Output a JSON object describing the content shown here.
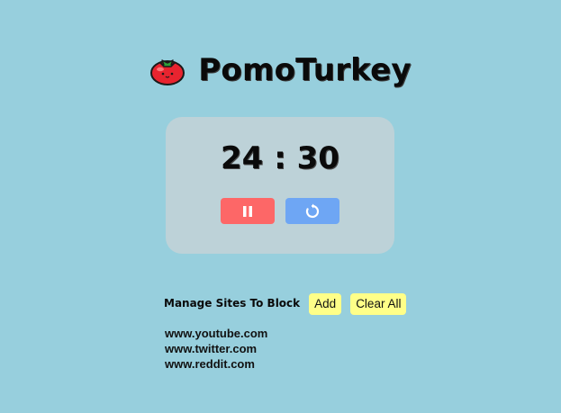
{
  "app": {
    "title": "PomoTurkey"
  },
  "timer": {
    "minutes": "24",
    "separator": ":",
    "seconds": "30"
  },
  "controls": {
    "pause_icon": "pause-icon",
    "reset_icon": "reset-icon"
  },
  "block_manager": {
    "label": "Manage Sites To Block",
    "add_label": "Add",
    "clear_label": "Clear All",
    "sites": [
      "www.youtube.com",
      "www.twitter.com",
      "www.reddit.com"
    ]
  },
  "colors": {
    "background": "#97cfdd",
    "card": "#bdd2d8",
    "pause_button": "#fd6767",
    "reset_button": "#6ea6f4",
    "action_button": "#ffff88",
    "tomato": "#e8242f"
  }
}
